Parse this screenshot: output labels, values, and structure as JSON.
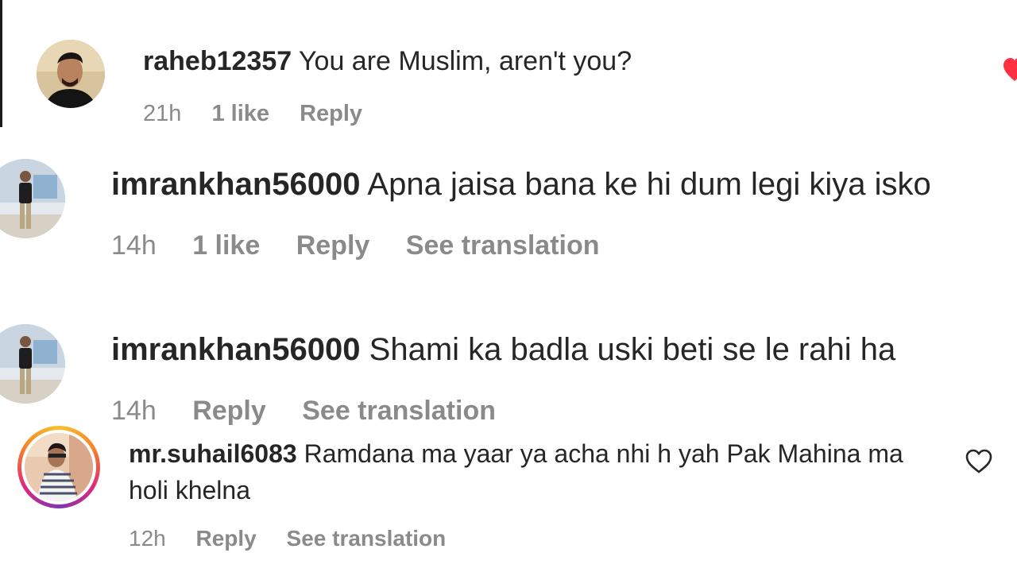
{
  "comments": [
    {
      "username": "raheb12357",
      "text": "You are Muslim, aren't you?",
      "time": "21h",
      "likes": "1 like",
      "reply": "Reply"
    },
    {
      "username": "imrankhan56000",
      "text": "Apna jaisa bana ke hi dum legi kiya isko",
      "time": "14h",
      "likes": "1 like",
      "reply": "Reply",
      "translate": "See translation"
    },
    {
      "username": "imrankhan56000",
      "text": "Shami ka badla uski beti se le rahi ha",
      "time": "14h",
      "reply": "Reply",
      "translate": "See translation"
    },
    {
      "username": "mr.suhail6083",
      "text": "Ramdana ma yaar ya acha nhi h yah Pak Mahina ma holi khelna",
      "time": "12h",
      "reply": "Reply",
      "translate": "See translation"
    }
  ],
  "icons": {
    "like": "heart-outline-icon",
    "liked": "heart-filled-icon"
  },
  "colors": {
    "text": "#262626",
    "muted": "#8a8a8a",
    "like_red": "#ff3040"
  }
}
